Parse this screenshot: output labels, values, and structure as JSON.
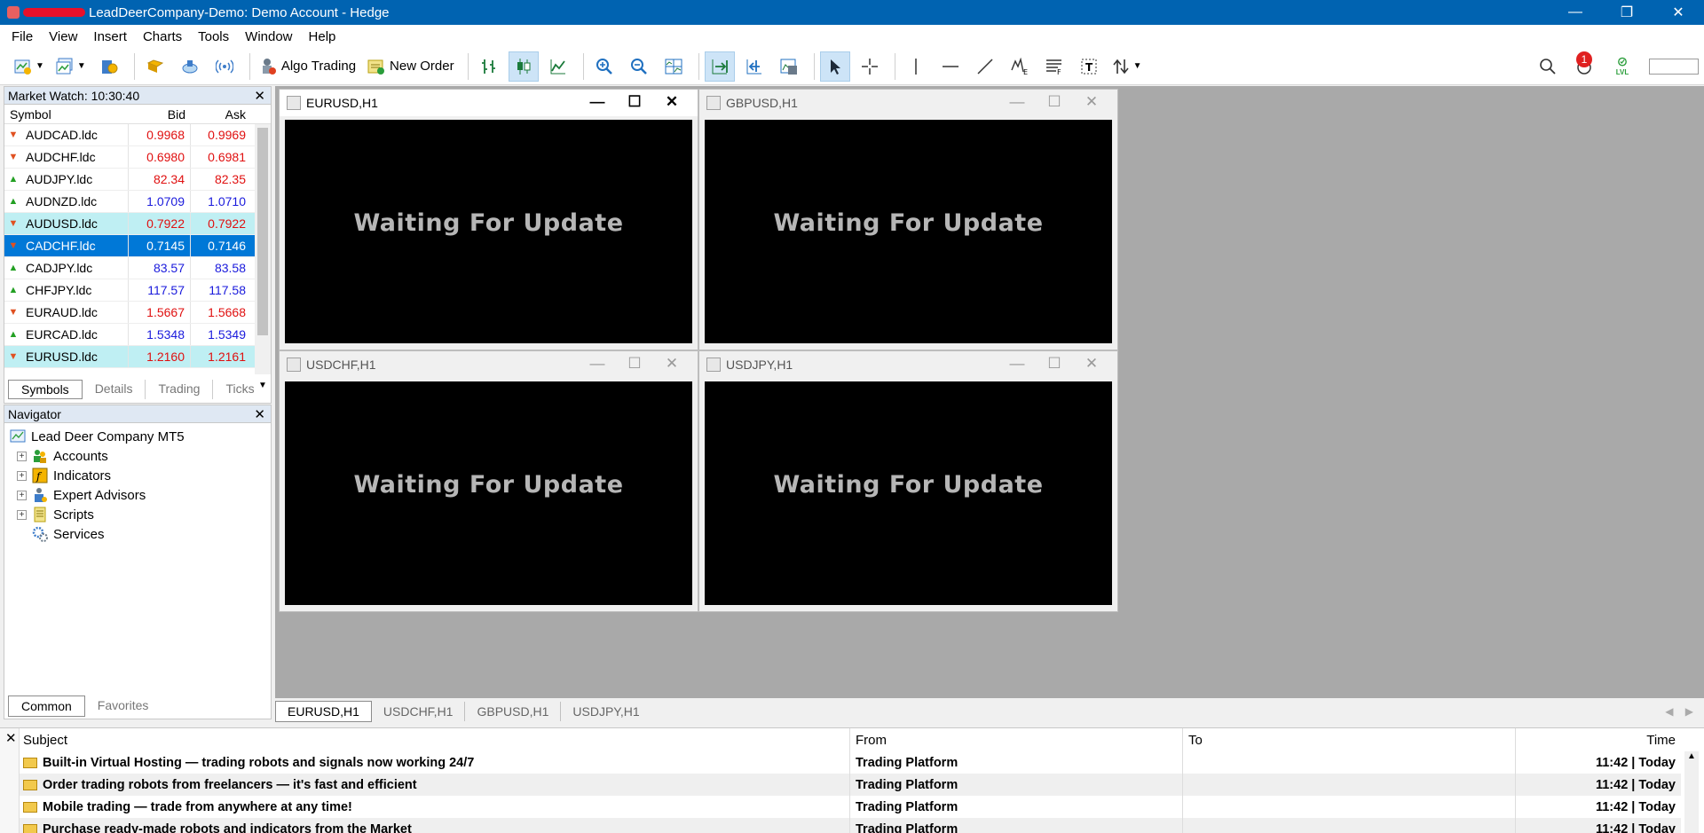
{
  "window": {
    "title": "LeadDeerCompany-Demo: Demo Account - Hedge",
    "minimize": "—",
    "restore": "❐",
    "close": "✕"
  },
  "menu": [
    "File",
    "View",
    "Insert",
    "Charts",
    "Tools",
    "Window",
    "Help"
  ],
  "toolbar": {
    "algo_trading": "Algo Trading",
    "new_order": "New Order",
    "notifications_count": "1",
    "level_label": "LVL"
  },
  "market_watch": {
    "title": "Market Watch: 10:30:40",
    "columns": [
      "Symbol",
      "Bid",
      "Ask"
    ],
    "rows": [
      {
        "symbol": "AUDCAD.ldc",
        "bid": "0.9968",
        "ask": "0.9969",
        "dir": "down",
        "color": "red"
      },
      {
        "symbol": "AUDCHF.ldc",
        "bid": "0.6980",
        "ask": "0.6981",
        "dir": "down",
        "color": "red"
      },
      {
        "symbol": "AUDJPY.ldc",
        "bid": "82.34",
        "ask": "82.35",
        "dir": "up",
        "color": "red"
      },
      {
        "symbol": "AUDNZD.ldc",
        "bid": "1.0709",
        "ask": "1.0710",
        "dir": "up",
        "color": "blue"
      },
      {
        "symbol": "AUDUSD.ldc",
        "bid": "0.7922",
        "ask": "0.7922",
        "dir": "down",
        "color": "red",
        "highlight": true
      },
      {
        "symbol": "CADCHF.ldc",
        "bid": "0.7145",
        "ask": "0.7146",
        "dir": "down",
        "color": "red",
        "selected": true
      },
      {
        "symbol": "CADJPY.ldc",
        "bid": "83.57",
        "ask": "83.58",
        "dir": "up",
        "color": "blue"
      },
      {
        "symbol": "CHFJPY.ldc",
        "bid": "117.57",
        "ask": "117.58",
        "dir": "up",
        "color": "blue"
      },
      {
        "symbol": "EURAUD.ldc",
        "bid": "1.5667",
        "ask": "1.5668",
        "dir": "down",
        "color": "red"
      },
      {
        "symbol": "EURCAD.ldc",
        "bid": "1.5348",
        "ask": "1.5349",
        "dir": "up",
        "color": "blue"
      },
      {
        "symbol": "EURUSD.ldc",
        "bid": "1.2160",
        "ask": "1.2161",
        "dir": "down",
        "color": "red",
        "highlight": true
      }
    ],
    "tabs": [
      "Symbols",
      "Details",
      "Trading",
      "Ticks"
    ]
  },
  "navigator": {
    "title": "Navigator",
    "root": "Lead Deer Company MT5",
    "items": [
      "Accounts",
      "Indicators",
      "Expert Advisors",
      "Scripts",
      "Services"
    ],
    "tabs": [
      "Common",
      "Favorites"
    ]
  },
  "charts": [
    {
      "title": "EURUSD,H1",
      "status": "Waiting For Update"
    },
    {
      "title": "GBPUSD,H1",
      "status": "Waiting For Update"
    },
    {
      "title": "USDCHF,H1",
      "status": "Waiting For Update"
    },
    {
      "title": "USDJPY,H1",
      "status": "Waiting For Update"
    }
  ],
  "chart_tabs": [
    "EURUSD,H1",
    "USDCHF,H1",
    "GBPUSD,H1",
    "USDJPY,H1"
  ],
  "mailbox": {
    "columns": [
      "Subject",
      "From",
      "To",
      "Time"
    ],
    "rows": [
      {
        "subject": "Built-in Virtual Hosting — trading robots and signals now working 24/7",
        "from": "Trading Platform",
        "to": "",
        "time": "11:42 | Today"
      },
      {
        "subject": "Order trading robots from freelancers — it's fast and efficient",
        "from": "Trading Platform",
        "to": "",
        "time": "11:42 | Today"
      },
      {
        "subject": "Mobile trading — trade from anywhere at any time!",
        "from": "Trading Platform",
        "to": "",
        "time": "11:42 | Today"
      },
      {
        "subject": "Purchase ready-made robots and indicators from the Market",
        "from": "Trading Platform",
        "to": "",
        "time": "11:42 | Today"
      }
    ]
  }
}
